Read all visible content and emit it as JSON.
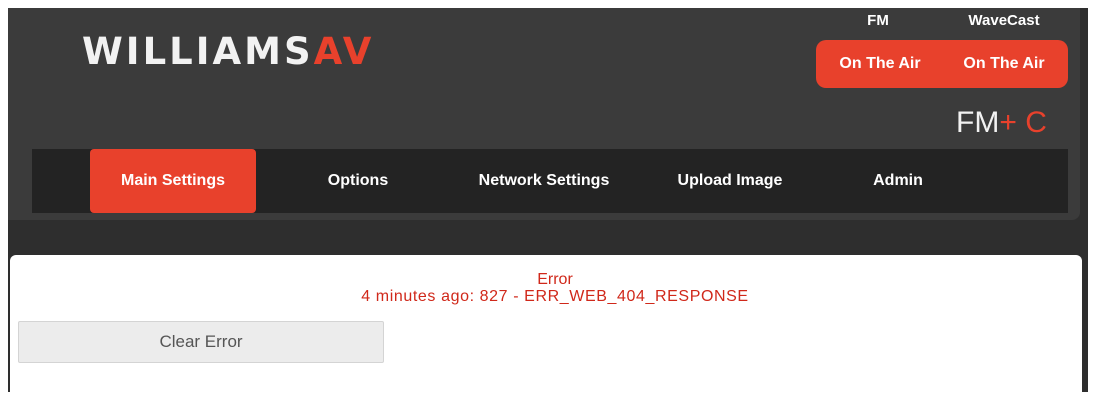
{
  "header": {
    "logo_main": "WILLIAMS",
    "logo_accent": "AV"
  },
  "on_air": {
    "fm_label": "FM",
    "wavecast_label": "WaveCast",
    "fm_status": "On The Air",
    "wavecast_status": "On The Air"
  },
  "brand_mark": {
    "main": "FM",
    "plus": "+",
    "suffix": "C"
  },
  "nav": {
    "items": [
      {
        "label": "Main Settings",
        "active": true
      },
      {
        "label": "Options",
        "active": false
      },
      {
        "label": "Network Settings",
        "active": false
      },
      {
        "label": "Upload Image",
        "active": false
      },
      {
        "label": "Admin",
        "active": false
      }
    ]
  },
  "error": {
    "title": "Error",
    "message": "4 minutes ago: 827 - ERR_WEB_404_RESPONSE",
    "clear_button": "Clear Error"
  },
  "colors": {
    "accent": "#e8412c",
    "header_bg": "#3b3b3b",
    "nav_bg": "#232323",
    "error_text": "#d0281a"
  }
}
